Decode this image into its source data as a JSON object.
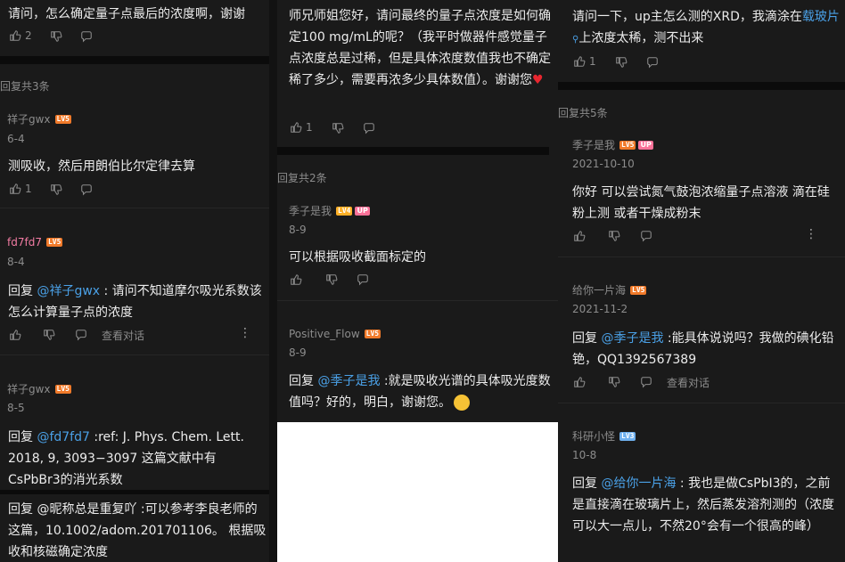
{
  "col1": {
    "top_comment": "请问，怎么确定量子点最后的浓度啊，谢谢",
    "top_like_count": "2",
    "reply_total": "回复共3条",
    "replies": [
      {
        "user": "祥子gwx",
        "level": "LV5",
        "date": "6-4",
        "text": "测吸收，然后用朗伯比尔定律去算",
        "likes": "1"
      },
      {
        "user": "fd7fd7",
        "level": "LV5",
        "date": "8-4",
        "reply_prefix": "回复 ",
        "mention": "@祥子gwx",
        "text": " : 请问不知道摩尔吸光系数该怎么计算量子点的浓度",
        "view_dialog": "查看对话"
      },
      {
        "user": "祥子gwx",
        "level": "LV5",
        "date": "8-5",
        "reply_prefix": "回复 ",
        "mention": "@fd7fd7",
        "text": " :ref: J. Phys. Chem. Lett. 2018, 9, 3093−3097 这篇文献中有CsPbBr3的消光系数"
      }
    ],
    "bottom_text": "回复 @昵称总是重复吖 :可以参考李良老师的这篇，10.1002/adom.201701106。 根据吸收和核磁确定浓度"
  },
  "col2": {
    "top_comment": "师兄师姐您好，请问最终的量子点浓度是如何确定100 mg/mL的呢？（我平时做器件感觉量子点浓度总是过稀，但是具体浓度数值我也不确定稀了多少，需要再浓多少具体数值）。谢谢您",
    "top_like_count": "1",
    "reply_total": "回复共2条",
    "replies": [
      {
        "user": "季子是我",
        "level": "LV4",
        "badge": "UP",
        "date": "8-9",
        "text": "可以根据吸收截面标定的"
      },
      {
        "user": "Positive_Flow",
        "level": "LV5",
        "date": "8-9",
        "reply_prefix": "回复 ",
        "mention": "@季子是我",
        "text": " :就是吸收光谱的具体吸光度数值吗？好的，明白，谢谢您。"
      }
    ]
  },
  "col3": {
    "top_comment_a": "请问一下，up主怎么测的XRD，我滴涂在",
    "top_comment_link": "载玻片",
    "top_comment_b": "上浓度太稀，测不出来",
    "top_like_count": "1",
    "reply_total": "回复共5条",
    "replies": [
      {
        "user": "季子是我",
        "level": "LV5",
        "badge": "UP",
        "date": "2021-10-10",
        "text": "你好 可以尝试氮气鼓泡浓缩量子点溶液 滴在硅粉上测 或者干燥成粉末"
      },
      {
        "user": "给你一片海",
        "level": "LV5",
        "date": "2021-11-2",
        "reply_prefix": "回复 ",
        "mention": "@季子是我",
        "text": " :能具体说说吗？我做的碘化铅铯，QQ1392567389",
        "view_dialog": "查看对话"
      },
      {
        "user": "科研小怪",
        "level": "LV3",
        "date": "10-8",
        "reply_prefix": "回复 ",
        "mention": "@给你一片海",
        "text": " : 我也是做CsPbI3的，之前是直接滴在玻璃片上，然后蒸发溶剂测的（浓度可以大一点儿，不然20°会有一个很高的峰）"
      }
    ]
  },
  "icons": {
    "like": "thumb-up-icon",
    "dislike": "thumb-down-icon",
    "reply": "comment-bubble-icon",
    "more": "more-vertical-icon",
    "search": "search-icon"
  },
  "colors": {
    "mention": "#4aa0e6",
    "lv5": "#f07a2a",
    "lv4": "#ffb027",
    "lv3": "#6fb0ee",
    "up_badge": "#fb7299"
  }
}
